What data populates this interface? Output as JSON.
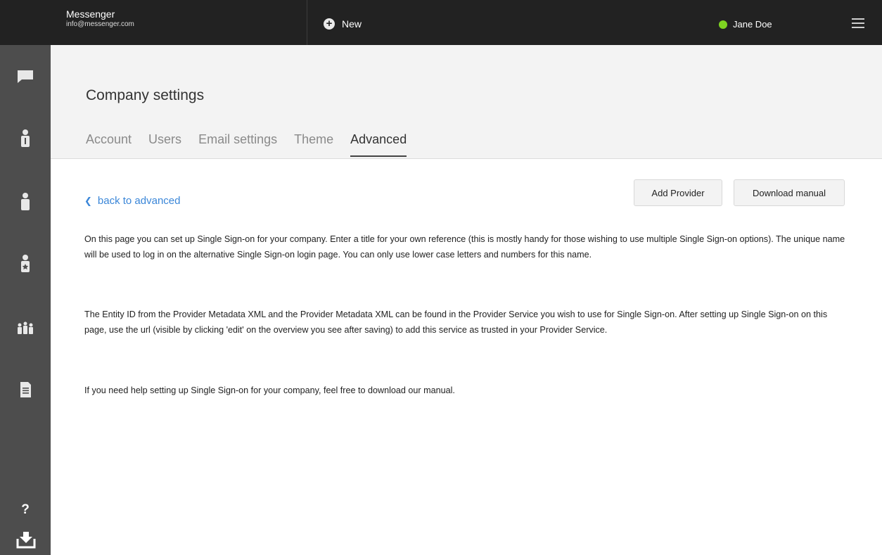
{
  "brand": {
    "name": "Messenger",
    "email": "info@messenger.com"
  },
  "toolbar": {
    "new_label": "New"
  },
  "user": {
    "name": "Jane Doe",
    "status_color": "#7ed321"
  },
  "sidebar": {
    "items": [
      {
        "icon": "chat-icon"
      },
      {
        "icon": "user-info-icon"
      },
      {
        "icon": "user-icon"
      },
      {
        "icon": "user-star-icon"
      },
      {
        "icon": "group-icon"
      },
      {
        "icon": "document-icon"
      }
    ],
    "help_label": "?",
    "bottom_icon": "download-icon"
  },
  "page": {
    "title": "Company settings",
    "tabs": [
      {
        "label": "Account",
        "active": false
      },
      {
        "label": "Users",
        "active": false
      },
      {
        "label": "Email settings",
        "active": false
      },
      {
        "label": "Theme",
        "active": false
      },
      {
        "label": "Advanced",
        "active": true
      }
    ]
  },
  "content": {
    "back_label": "back to advanced",
    "add_provider_label": "Add Provider",
    "download_manual_label": "Download manual",
    "paragraphs": [
      "On this page you can set up Single Sign-on for your company. Enter a title for your own reference (this is mostly handy for those wishing to use multiple Single Sign-on options). The unique name will be used to log in on the alternative Single Sign-on login page. You can only use lower case letters and numbers for this name.",
      "The Entity ID from the Provider Metadata XML and the Provider Metadata XML can be found in the Provider Service you wish to use for Single Sign-on. After setting up Single Sign-on on this page, use the url (visible by clicking 'edit' on the overview you see after saving) to add this service as trusted in your Provider Service.",
      "If you need help setting up Single Sign-on for your company, feel free to download our manual."
    ]
  },
  "colors": {
    "topbar": "#222222",
    "sidebar": "#4d4d4d",
    "header": "#f3f3f3",
    "link": "#3a86d8"
  }
}
